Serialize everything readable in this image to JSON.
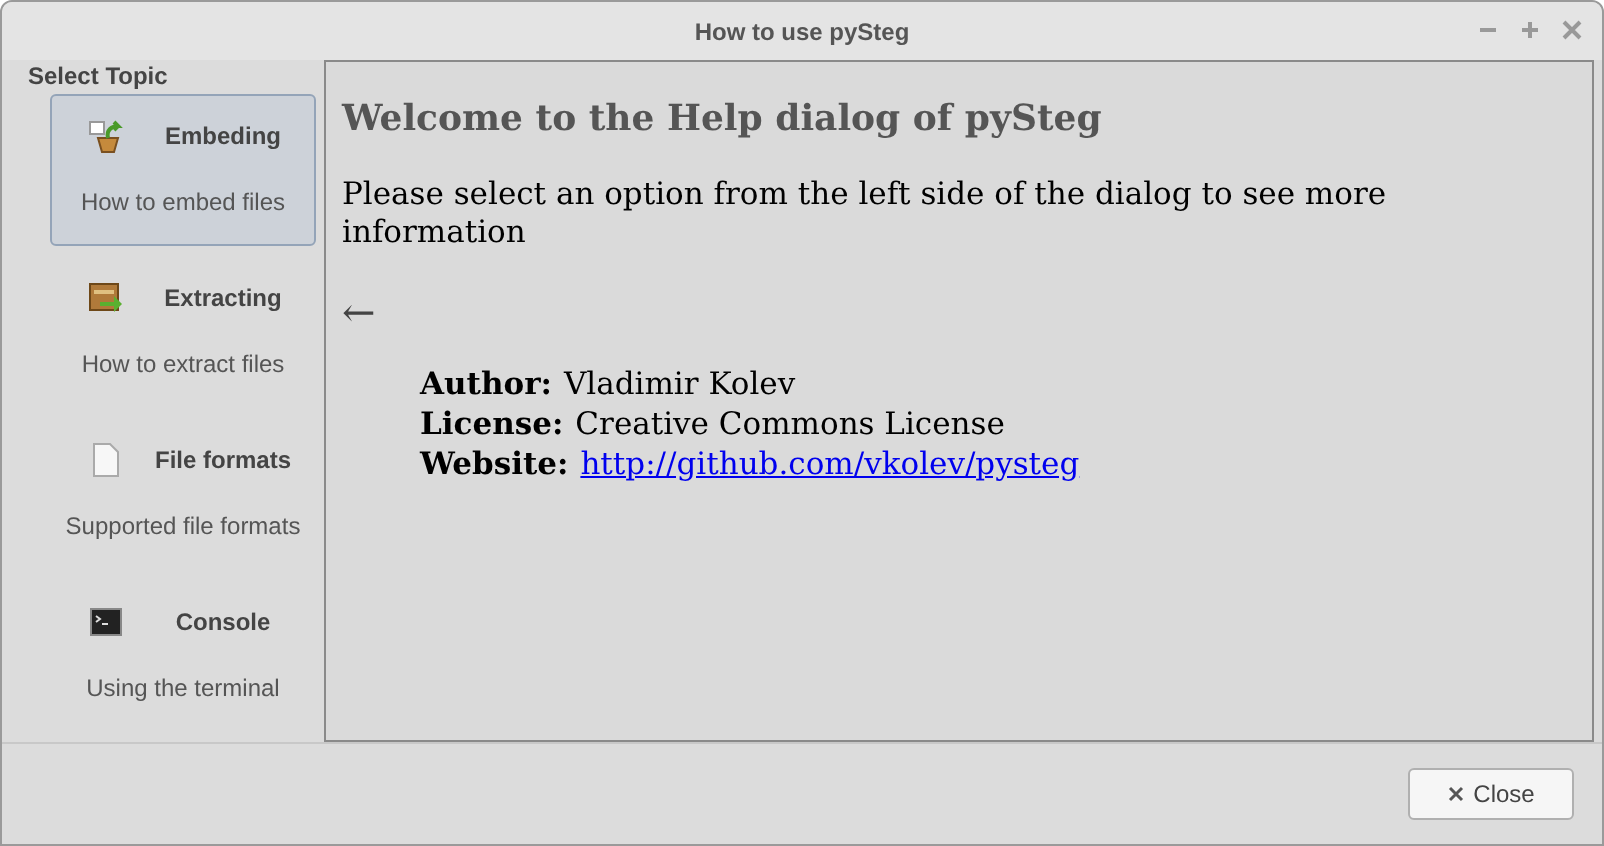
{
  "window": {
    "title": "How to use pySteg"
  },
  "sidebar": {
    "heading": "Select Topic",
    "items": [
      {
        "kind": "embed",
        "label": "Embeding",
        "description": "How to embed files",
        "selected": true
      },
      {
        "kind": "extract",
        "label": "Extracting",
        "description": "How to extract files",
        "selected": false
      },
      {
        "kind": "file",
        "label": "File formats",
        "description": "Supported file formats",
        "selected": false
      },
      {
        "kind": "console",
        "label": "Console",
        "description": "Using the terminal",
        "selected": false
      }
    ]
  },
  "content": {
    "heading": "Welcome to the Help dialog of pySteg",
    "intro": "Please select an option from the left side of the dialog to see more information",
    "arrow": "←",
    "details": [
      {
        "label": "Author:",
        "value": "Vladimir Kolev",
        "kind": "text"
      },
      {
        "label": "License:",
        "value": "Creative Commons License",
        "kind": "text"
      },
      {
        "label": "Website:",
        "value": "http://github.com/vkolev/pysteg",
        "kind": "link"
      }
    ]
  },
  "buttons": [
    {
      "label": "Close"
    }
  ]
}
